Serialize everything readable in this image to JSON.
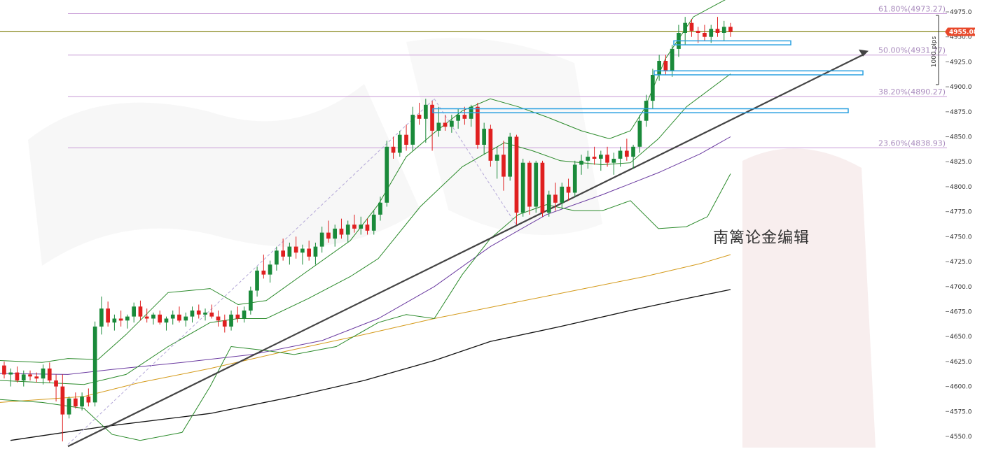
{
  "chart_data": {
    "type": "candlestick",
    "price_axis": {
      "ticks": [
        "4975.0",
        "4950.0",
        "4925.0",
        "4900.0",
        "4875.0",
        "4850.0",
        "4825.0",
        "4800.0",
        "4775.0",
        "4750.0",
        "4725.0",
        "4700.0",
        "4675.0",
        "4650.0",
        "4625.0",
        "4600.0",
        "4575.0",
        "4550.0"
      ],
      "min": 4540,
      "max": 4985
    },
    "current_price": {
      "label": "4955.08",
      "value": 4955.08,
      "color": "#e8482a"
    },
    "current_line_value": 4955.08,
    "fibonacci": [
      {
        "label": "61.80%(4973.27)",
        "value": 4973.27
      },
      {
        "label": "50.00%(4931.77)",
        "value": 4931.77
      },
      {
        "label": "38.20%(4890.27)",
        "value": 4890.27
      },
      {
        "label": "23.60%(4838.93)",
        "value": 4838.93
      }
    ],
    "pips_label": "1000 pips",
    "watermark": "南篱论金编辑",
    "colors": {
      "up": "#1a8a3a",
      "down": "#e02020",
      "fib": "#c79ad6",
      "current": "#7a7a00",
      "zone": "#2aa0e0",
      "trend": "#444444",
      "ma_purple": "#6a3aa0",
      "ma_orange": "#d49a1a",
      "ma_black": "#111111",
      "bollinger": "#2a8a2a"
    },
    "candles": [
      [
        4621,
        4625,
        4608,
        4612
      ],
      [
        4612,
        4618,
        4600,
        4614
      ],
      [
        4614,
        4620,
        4604,
        4606
      ],
      [
        4606,
        4616,
        4600,
        4612
      ],
      [
        4612,
        4616,
        4606,
        4610
      ],
      [
        4610,
        4614,
        4604,
        4608
      ],
      [
        4608,
        4622,
        4602,
        4618
      ],
      [
        4618,
        4624,
        4604,
        4606
      ],
      [
        4606,
        4612,
        4585,
        4600
      ],
      [
        4600,
        4612,
        4545,
        4572
      ],
      [
        4572,
        4590,
        4568,
        4588
      ],
      [
        4588,
        4594,
        4578,
        4580
      ],
      [
        4580,
        4594,
        4576,
        4590
      ],
      [
        4590,
        4598,
        4580,
        4584
      ],
      [
        4584,
        4665,
        4580,
        4660
      ],
      [
        4660,
        4690,
        4652,
        4678
      ],
      [
        4678,
        4685,
        4660,
        4664
      ],
      [
        4664,
        4672,
        4656,
        4668
      ],
      [
        4668,
        4676,
        4660,
        4666
      ],
      [
        4666,
        4672,
        4658,
        4670
      ],
      [
        4670,
        4684,
        4664,
        4680
      ],
      [
        4680,
        4686,
        4666,
        4670
      ],
      [
        4670,
        4678,
        4664,
        4668
      ],
      [
        4668,
        4674,
        4662,
        4672
      ],
      [
        4672,
        4676,
        4662,
        4664
      ],
      [
        4664,
        4670,
        4656,
        4668
      ],
      [
        4668,
        4676,
        4662,
        4672
      ],
      [
        4672,
        4680,
        4664,
        4666
      ],
      [
        4666,
        4674,
        4660,
        4670
      ],
      [
        4670,
        4680,
        4664,
        4676
      ],
      [
        4676,
        4682,
        4668,
        4672
      ],
      [
        4672,
        4678,
        4666,
        4674
      ],
      [
        4674,
        4682,
        4668,
        4670
      ],
      [
        4670,
        4676,
        4660,
        4666
      ],
      [
        4666,
        4672,
        4654,
        4660
      ],
      [
        4660,
        4676,
        4656,
        4672
      ],
      [
        4672,
        4680,
        4664,
        4668
      ],
      [
        4668,
        4680,
        4664,
        4676
      ],
      [
        4676,
        4700,
        4672,
        4696
      ],
      [
        4696,
        4720,
        4690,
        4716
      ],
      [
        4716,
        4732,
        4708,
        4712
      ],
      [
        4712,
        4726,
        4704,
        4722
      ],
      [
        4722,
        4740,
        4716,
        4736
      ],
      [
        4736,
        4748,
        4726,
        4730
      ],
      [
        4730,
        4744,
        4722,
        4740
      ],
      [
        4740,
        4750,
        4728,
        4734
      ],
      [
        4734,
        4742,
        4722,
        4738
      ],
      [
        4738,
        4746,
        4726,
        4730
      ],
      [
        4730,
        4744,
        4722,
        4740
      ],
      [
        4740,
        4760,
        4734,
        4754
      ],
      [
        4754,
        4766,
        4744,
        4748
      ],
      [
        4748,
        4762,
        4740,
        4758
      ],
      [
        4758,
        4768,
        4748,
        4752
      ],
      [
        4752,
        4766,
        4744,
        4762
      ],
      [
        4762,
        4772,
        4754,
        4758
      ],
      [
        4758,
        4770,
        4752,
        4762
      ],
      [
        4762,
        4768,
        4752,
        4756
      ],
      [
        4756,
        4776,
        4752,
        4772
      ],
      [
        4772,
        4790,
        4766,
        4784
      ],
      [
        4784,
        4846,
        4780,
        4840
      ],
      [
        4840,
        4850,
        4828,
        4834
      ],
      [
        4834,
        4856,
        4830,
        4852
      ],
      [
        4852,
        4862,
        4836,
        4842
      ],
      [
        4842,
        4880,
        4836,
        4872
      ],
      [
        4872,
        4884,
        4862,
        4868
      ],
      [
        4868,
        4888,
        4844,
        4882
      ],
      [
        4882,
        4886,
        4836,
        4856
      ],
      [
        4856,
        4880,
        4850,
        4864
      ],
      [
        4864,
        4872,
        4856,
        4860
      ],
      [
        4860,
        4872,
        4854,
        4866
      ],
      [
        4866,
        4878,
        4858,
        4872
      ],
      [
        4872,
        4880,
        4862,
        4868
      ],
      [
        4868,
        4882,
        4860,
        4880
      ],
      [
        4880,
        4884,
        4838,
        4842
      ],
      [
        4842,
        4864,
        4832,
        4858
      ],
      [
        4858,
        4862,
        4820,
        4826
      ],
      [
        4826,
        4840,
        4808,
        4832
      ],
      [
        4832,
        4846,
        4796,
        4810
      ],
      [
        4810,
        4854,
        4806,
        4850
      ],
      [
        4850,
        4852,
        4762,
        4774
      ],
      [
        4774,
        4828,
        4770,
        4824
      ],
      [
        4824,
        4826,
        4772,
        4780
      ],
      [
        4780,
        4826,
        4774,
        4824
      ],
      [
        4824,
        4826,
        4770,
        4774
      ],
      [
        4774,
        4796,
        4770,
        4792
      ],
      [
        4792,
        4804,
        4776,
        4784
      ],
      [
        4784,
        4804,
        4778,
        4800
      ],
      [
        4800,
        4808,
        4786,
        4794
      ],
      [
        4794,
        4826,
        4790,
        4822
      ],
      [
        4822,
        4832,
        4812,
        4826
      ],
      [
        4826,
        4836,
        4818,
        4830
      ],
      [
        4830,
        4840,
        4822,
        4828
      ],
      [
        4828,
        4836,
        4816,
        4832
      ],
      [
        4832,
        4840,
        4820,
        4824
      ],
      [
        4824,
        4834,
        4812,
        4828
      ],
      [
        4828,
        4840,
        4820,
        4836
      ],
      [
        4836,
        4848,
        4826,
        4830
      ],
      [
        4830,
        4842,
        4818,
        4840
      ],
      [
        4840,
        4872,
        4834,
        4866
      ],
      [
        4866,
        4892,
        4860,
        4886
      ],
      [
        4886,
        4918,
        4878,
        4912
      ],
      [
        4912,
        4932,
        4906,
        4926
      ],
      [
        4926,
        4932,
        4912,
        4916
      ],
      [
        4916,
        4942,
        4910,
        4938
      ],
      [
        4938,
        4962,
        4930,
        4954
      ],
      [
        4954,
        4970,
        4942,
        4964
      ],
      [
        4964,
        4968,
        4950,
        4956
      ],
      [
        4956,
        4960,
        4944,
        4954
      ],
      [
        4954,
        4962,
        4946,
        4950
      ],
      [
        4950,
        4962,
        4944,
        4958
      ],
      [
        4958,
        4970,
        4950,
        4954
      ],
      [
        4954,
        4966,
        4946,
        4960
      ],
      [
        4960,
        4964,
        4950,
        4955
      ]
    ]
  }
}
